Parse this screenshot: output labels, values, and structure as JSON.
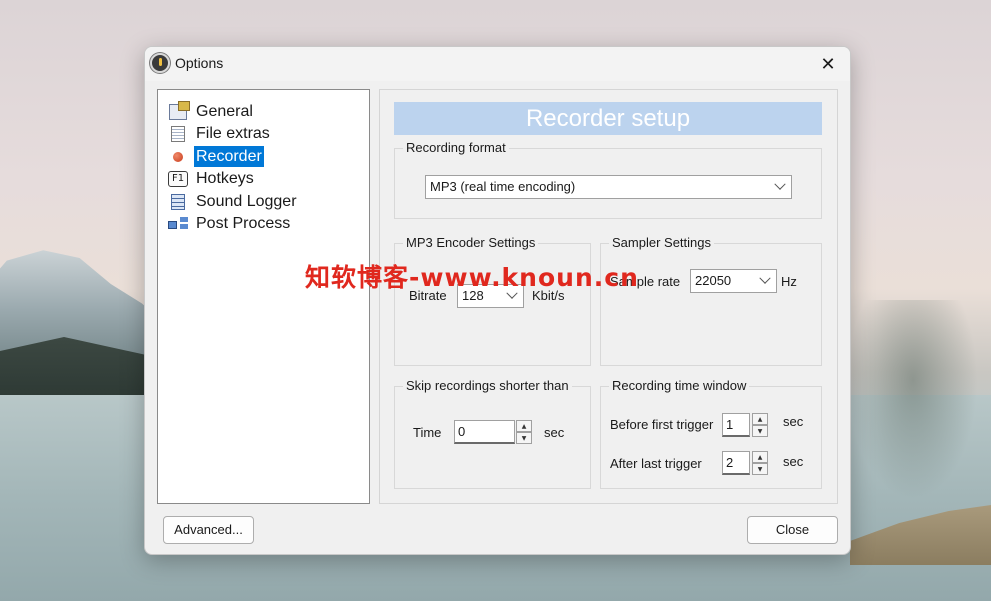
{
  "window": {
    "title": "Options"
  },
  "tree": {
    "items": [
      {
        "label": "General"
      },
      {
        "label": "File extras"
      },
      {
        "label": "Recorder"
      },
      {
        "label": "Hotkeys"
      },
      {
        "label": "Sound Logger"
      },
      {
        "label": "Post Process"
      }
    ],
    "selected": "Recorder",
    "hotkeys_icon_text": "F1"
  },
  "recorder": {
    "header": "Recorder setup",
    "recording_format": {
      "title": "Recording format",
      "value": "MP3 (real time encoding)"
    },
    "mp3_encoder": {
      "title": "MP3 Encoder Settings",
      "bitrate_label": "Bitrate",
      "bitrate_value": "128",
      "bitrate_unit": "Kbit/s"
    },
    "sampler": {
      "title": "Sampler Settings",
      "sample_rate_label": "Sample rate",
      "sample_rate_value": "22050",
      "sample_rate_unit": "Hz"
    },
    "skip_recordings": {
      "title": "Skip recordings shorter than",
      "time_label": "Time",
      "time_value": "0",
      "time_unit": "sec"
    },
    "time_window": {
      "title": "Recording time window",
      "before_label": "Before first trigger",
      "before_value": "1",
      "before_unit": "sec",
      "after_label": "After last trigger",
      "after_value": "2",
      "after_unit": "sec"
    }
  },
  "buttons": {
    "advanced": "Advanced...",
    "close": "Close"
  },
  "watermark": "知软博客-www.knoun.cn",
  "colors": {
    "selection": "#0078d7",
    "header_bg": "#bcd3ee",
    "watermark": "#e0281e"
  }
}
